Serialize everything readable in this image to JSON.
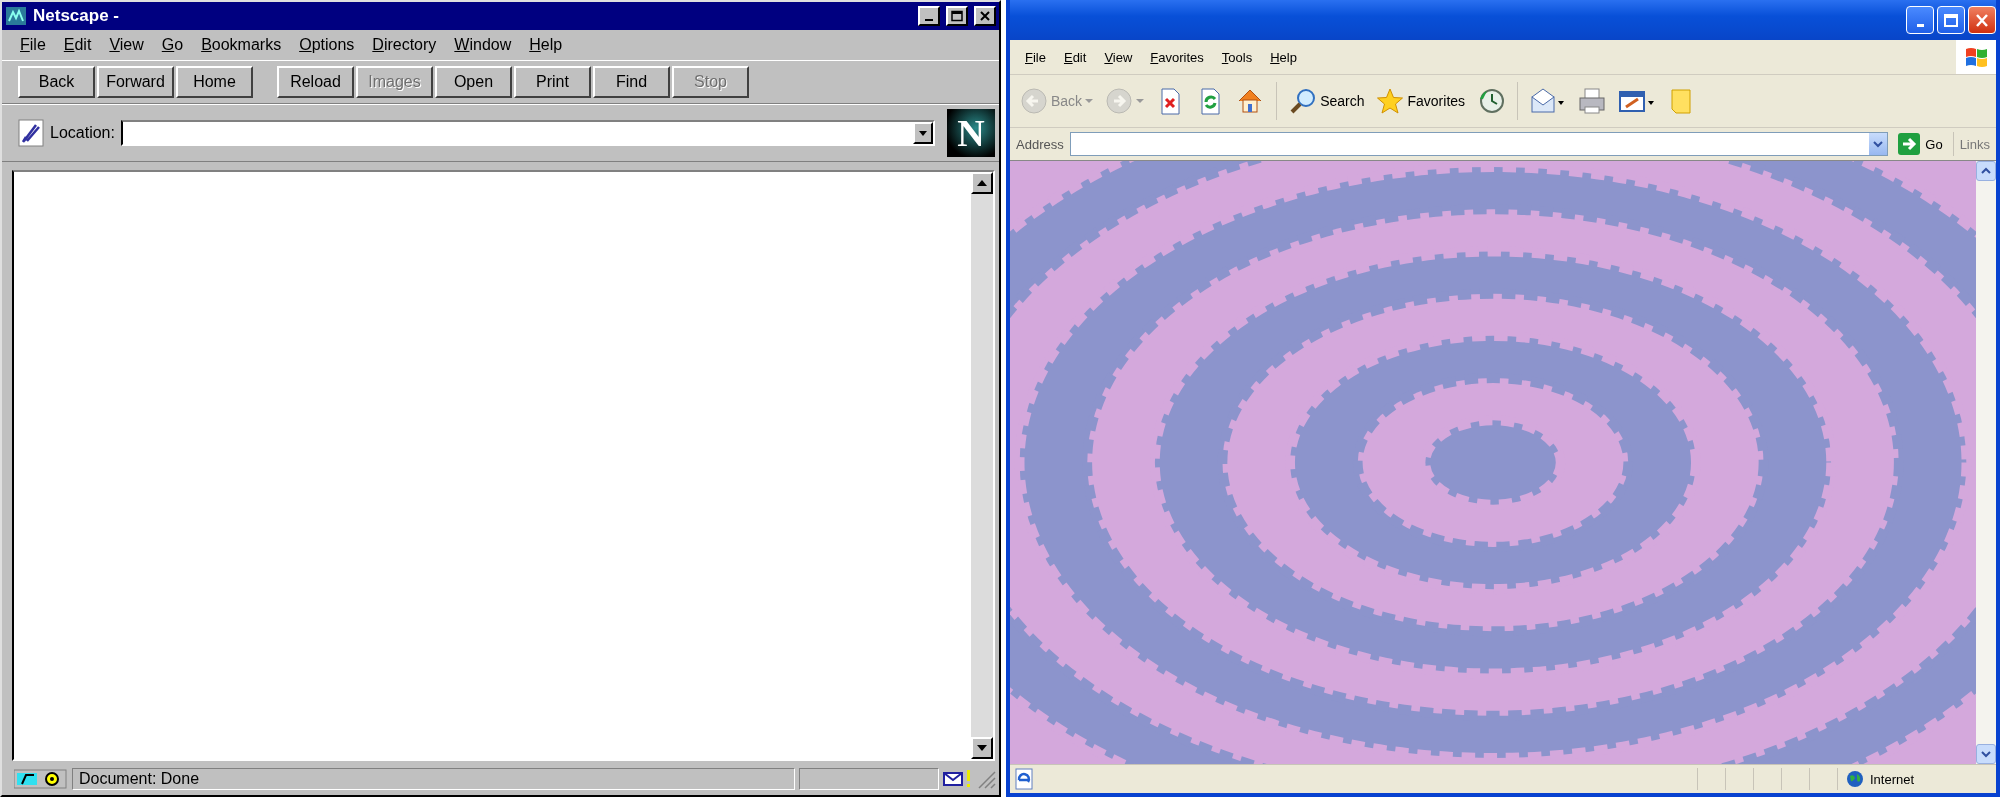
{
  "netscape": {
    "title": "Netscape -",
    "menu": [
      "File",
      "Edit",
      "View",
      "Go",
      "Bookmarks",
      "Options",
      "Directory",
      "Window",
      "Help"
    ],
    "toolbar_groups": [
      [
        {
          "label": "Back",
          "disabled": false
        },
        {
          "label": "Forward",
          "disabled": false
        },
        {
          "label": "Home",
          "disabled": false
        }
      ],
      [
        {
          "label": "Reload",
          "disabled": false
        },
        {
          "label": "Images",
          "disabled": true
        },
        {
          "label": "Open",
          "disabled": false
        },
        {
          "label": "Print",
          "disabled": false
        },
        {
          "label": "Find",
          "disabled": false
        },
        {
          "label": "Stop",
          "disabled": true
        }
      ]
    ],
    "location_label": "Location:",
    "logo": "N",
    "status": "Document: Done"
  },
  "explorer": {
    "menu": [
      "File",
      "Edit",
      "View",
      "Favorites",
      "Tools",
      "Help"
    ],
    "toolbar": [
      {
        "kind": "back",
        "label": "Back",
        "disabled": true
      },
      {
        "kind": "forward",
        "disabled": true
      },
      {
        "kind": "stop",
        "disabled": false
      },
      {
        "kind": "refresh",
        "disabled": false
      },
      {
        "kind": "home",
        "disabled": false
      },
      {
        "kind": "search",
        "label": "Search",
        "disabled": false
      },
      {
        "kind": "favorites",
        "label": "Favorites",
        "disabled": false
      },
      {
        "kind": "history",
        "disabled": false
      },
      {
        "kind": "mail",
        "disabled": false
      },
      {
        "kind": "print",
        "disabled": false
      },
      {
        "kind": "edit",
        "disabled": false
      },
      {
        "kind": "notes",
        "disabled": false
      }
    ],
    "address_label": "Address",
    "go": "Go",
    "links": "Links",
    "zone": "Internet"
  }
}
